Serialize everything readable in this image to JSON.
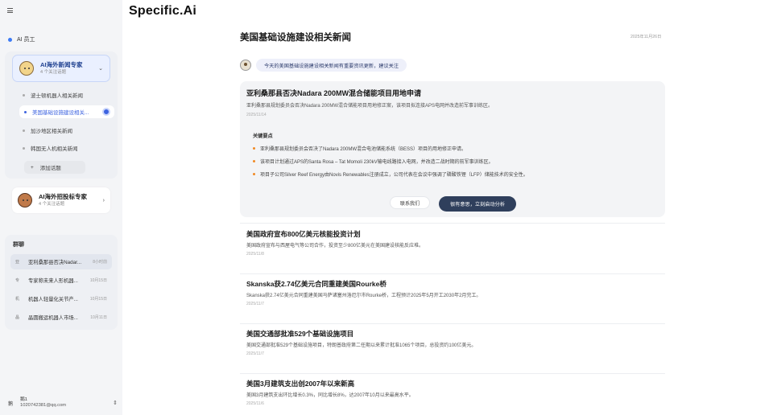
{
  "sidebar": {
    "staff_label": "AI 员工",
    "expert1": {
      "name": "AI海外新闻专家",
      "sub": "4 个关注话题"
    },
    "topics": [
      "波士顿机器人相关新闻",
      "美国基础设施建设相关...",
      "加沙地区相关新闻",
      "韩国无人机相关新闻"
    ],
    "add_topic": "添加话题",
    "expert2": {
      "name": "AI海外招投标专家",
      "sub": "4 个关注话题"
    },
    "group_title": "群聊",
    "groups": [
      {
        "icon": "亚",
        "text": "亚利桑那县否决Nadar...",
        "date": "8小时前"
      },
      {
        "icon": "专",
        "text": "专家称未来人形机器...",
        "date": "10月15日"
      },
      {
        "icon": "机",
        "text": "机器人轻量化关节产...",
        "date": "10月15日"
      },
      {
        "icon": "晶",
        "text": "晶圆搬运机器人市场...",
        "date": "10月11日"
      }
    ],
    "user": {
      "icon": "鹅",
      "name": "鹅1",
      "email": "1020742381@qq.com"
    }
  },
  "main": {
    "logo": "Specific.Ai",
    "title": "美国基础设施建设相关新闻",
    "date": "2025年11月26日",
    "bot_message": "今天的美国基础设施建设相关新闻有重要资讯更新，建议关注",
    "featured": {
      "title": "亚利桑那县否决Nadara 200MW混合储能项目用地申请",
      "desc": "亚利桑那县规划委员会否决Nadara 200MW混合储能项目用地修正案，该项目拟连接APS电网并改造前军事训练区。",
      "date": "2025/11/14",
      "key_points_title": "关键要点",
      "key_points": [
        "亚利桑那县规划委员会否决了Nadara 200MW混合电池储能系统（BESS）项目的用地修正申请。",
        "该项目计划通过APS的Santa Rosa – Tat Momoli 230kV输电线路接入电网，并改造二战时期的前军事训练区。",
        "项目子公司Silver Reef Energy由Novis Renewables注册成立，公司代表在会议中强调了磷酸铁锂（LFP）储能技术的安全性。"
      ],
      "contact_label": "联系我们",
      "analyze_label": "很有意思，立刻启动分析"
    },
    "news": [
      {
        "title": "美国政府宣布800亿美元核能投资计划",
        "desc": "美国政府宣布与西屋电气等公司合作，投资至少800亿美元在美国建设核能反应堆。",
        "date": "2025/11/8"
      },
      {
        "title": "Skanska获2.74亿美元合同重建美国Rourke桥",
        "desc": "Skanska获2.74亿美元合同重建美国马萨诸塞州洛厄尔市Rourke桥，工程预计2025年5月开工2030年2月完工。",
        "date": "2025/11/7"
      },
      {
        "title": "美国交通部批准529个基础设施项目",
        "desc": "美国交通部批准529个基础设施项目，特朗普政府第二任期以来累计批准1065个项目，总投资约100亿美元。",
        "date": "2025/11/7"
      },
      {
        "title": "美国3月建筑支出创2007年以来新高",
        "desc": "美国3月建筑支出环比增长0.3%，同比增长8%，达2007年10月以来最高水平。",
        "date": "2025/11/6"
      }
    ]
  }
}
